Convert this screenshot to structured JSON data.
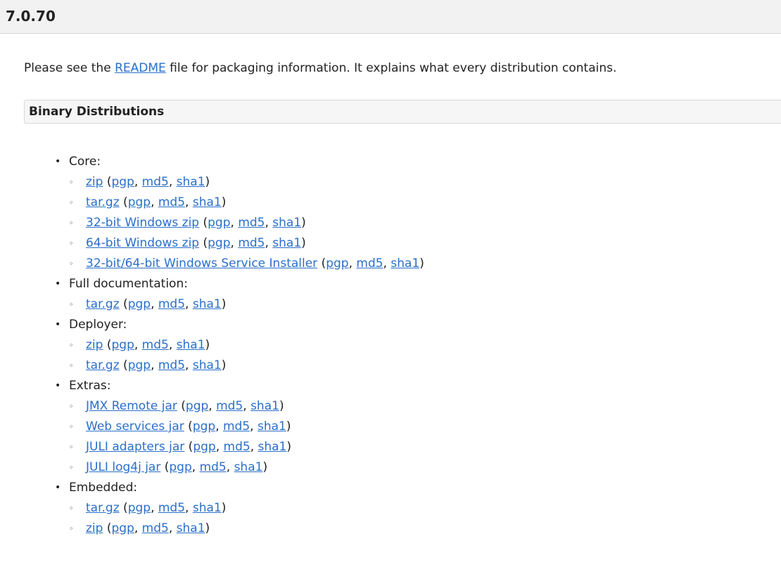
{
  "version": "7.0.70",
  "readme": {
    "prefix": "Please see the ",
    "link_text": "README",
    "suffix": " file for packaging information. It explains what every distribution contains."
  },
  "section_title": "Binary Distributions",
  "groups": [
    {
      "label": "Core:",
      "items": [
        {
          "main": "zip",
          "sigs": [
            "pgp",
            "md5",
            "sha1"
          ]
        },
        {
          "main": "tar.gz",
          "sigs": [
            "pgp",
            "md5",
            "sha1"
          ]
        },
        {
          "main": "32-bit Windows zip",
          "sigs": [
            "pgp",
            "md5",
            "sha1"
          ]
        },
        {
          "main": "64-bit Windows zip",
          "sigs": [
            "pgp",
            "md5",
            "sha1"
          ]
        },
        {
          "main": "32-bit/64-bit Windows Service Installer",
          "sigs": [
            "pgp",
            "md5",
            "sha1"
          ]
        }
      ]
    },
    {
      "label": "Full documentation:",
      "items": [
        {
          "main": "tar.gz",
          "sigs": [
            "pgp",
            "md5",
            "sha1"
          ]
        }
      ]
    },
    {
      "label": "Deployer:",
      "items": [
        {
          "main": "zip",
          "sigs": [
            "pgp",
            "md5",
            "sha1"
          ]
        },
        {
          "main": "tar.gz",
          "sigs": [
            "pgp",
            "md5",
            "sha1"
          ]
        }
      ]
    },
    {
      "label": "Extras:",
      "items": [
        {
          "main": "JMX Remote jar",
          "sigs": [
            "pgp",
            "md5",
            "sha1"
          ]
        },
        {
          "main": "Web services jar",
          "sigs": [
            "pgp",
            "md5",
            "sha1"
          ]
        },
        {
          "main": "JULI adapters jar",
          "sigs": [
            "pgp",
            "md5",
            "sha1"
          ]
        },
        {
          "main": "JULI log4j jar",
          "sigs": [
            "pgp",
            "md5",
            "sha1"
          ]
        }
      ]
    },
    {
      "label": "Embedded:",
      "items": [
        {
          "main": "tar.gz",
          "sigs": [
            "pgp",
            "md5",
            "sha1"
          ]
        },
        {
          "main": "zip",
          "sigs": [
            "pgp",
            "md5",
            "sha1"
          ]
        }
      ]
    }
  ]
}
